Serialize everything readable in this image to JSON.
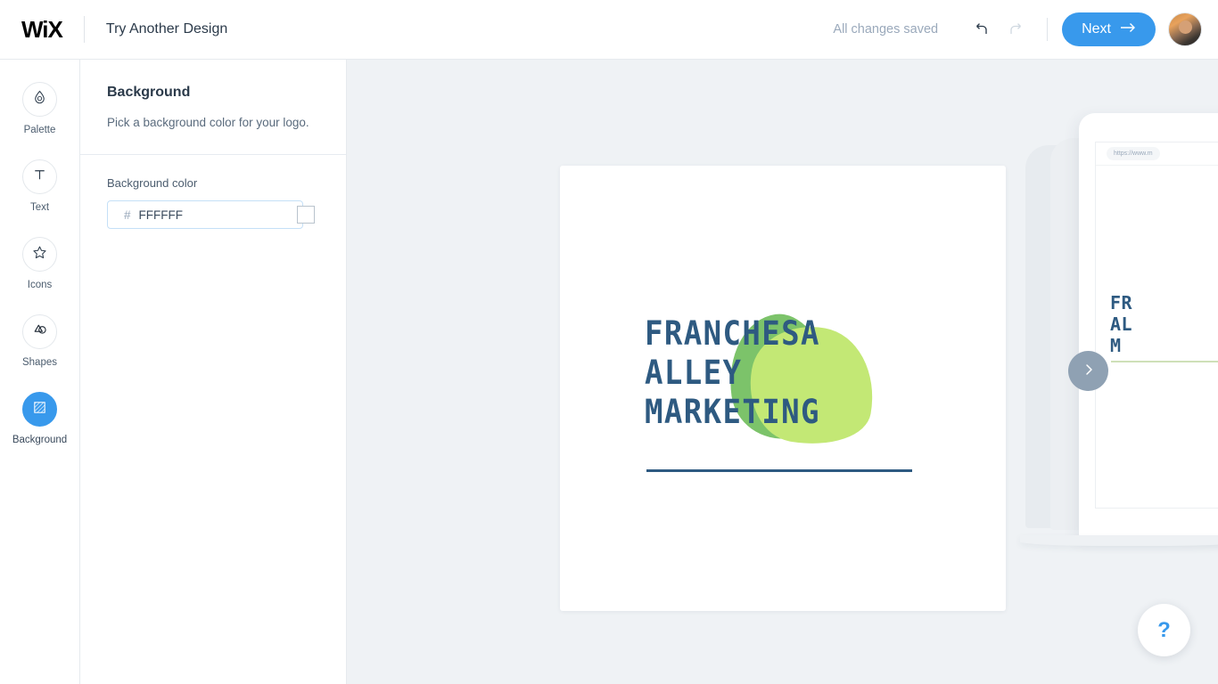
{
  "header": {
    "brand": "WiX",
    "title": "Try Another Design",
    "save_status": "All changes saved",
    "undo_icon": "undo-icon",
    "redo_icon": "redo-icon",
    "next_label": "Next",
    "next_arrow": "arrow-right-icon",
    "avatar": "user-avatar",
    "accent_color": "#3899ec"
  },
  "sidebar": {
    "items": [
      {
        "label": "Palette",
        "icon": "droplet-icon",
        "active": false
      },
      {
        "label": "Text",
        "icon": "text-t-icon",
        "active": false
      },
      {
        "label": "Icons",
        "icon": "star-icon",
        "active": false
      },
      {
        "label": "Shapes",
        "icon": "shapes-icon",
        "active": false
      },
      {
        "label": "Background",
        "icon": "hatched-square-icon",
        "active": true
      }
    ]
  },
  "panel": {
    "title": "Background",
    "description": "Pick a background color for your logo.",
    "field_label": "Background color",
    "hash_symbol": "#",
    "color_value": "FFFFFF",
    "color_placeholder": "FFFFFF",
    "swatch_color": "#FFFFFF"
  },
  "canvas": {
    "background_color": "#EFF2F5",
    "logo": {
      "line1": "FRANCHESA",
      "line2": "ALLEY",
      "line3": "MARKETING",
      "text_color": "#2E5A81",
      "blob_color_dark": "#7CC36A",
      "blob_color_light": "#C3E875",
      "card_color": "#FFFFFF"
    },
    "preview": {
      "url": "https://www.m",
      "logo_line1": "FR",
      "logo_line2": "AL",
      "logo_line3": "M"
    },
    "next_arrow_icon": "chevron-right-icon"
  },
  "help": {
    "label": "?",
    "name": "help-button"
  }
}
